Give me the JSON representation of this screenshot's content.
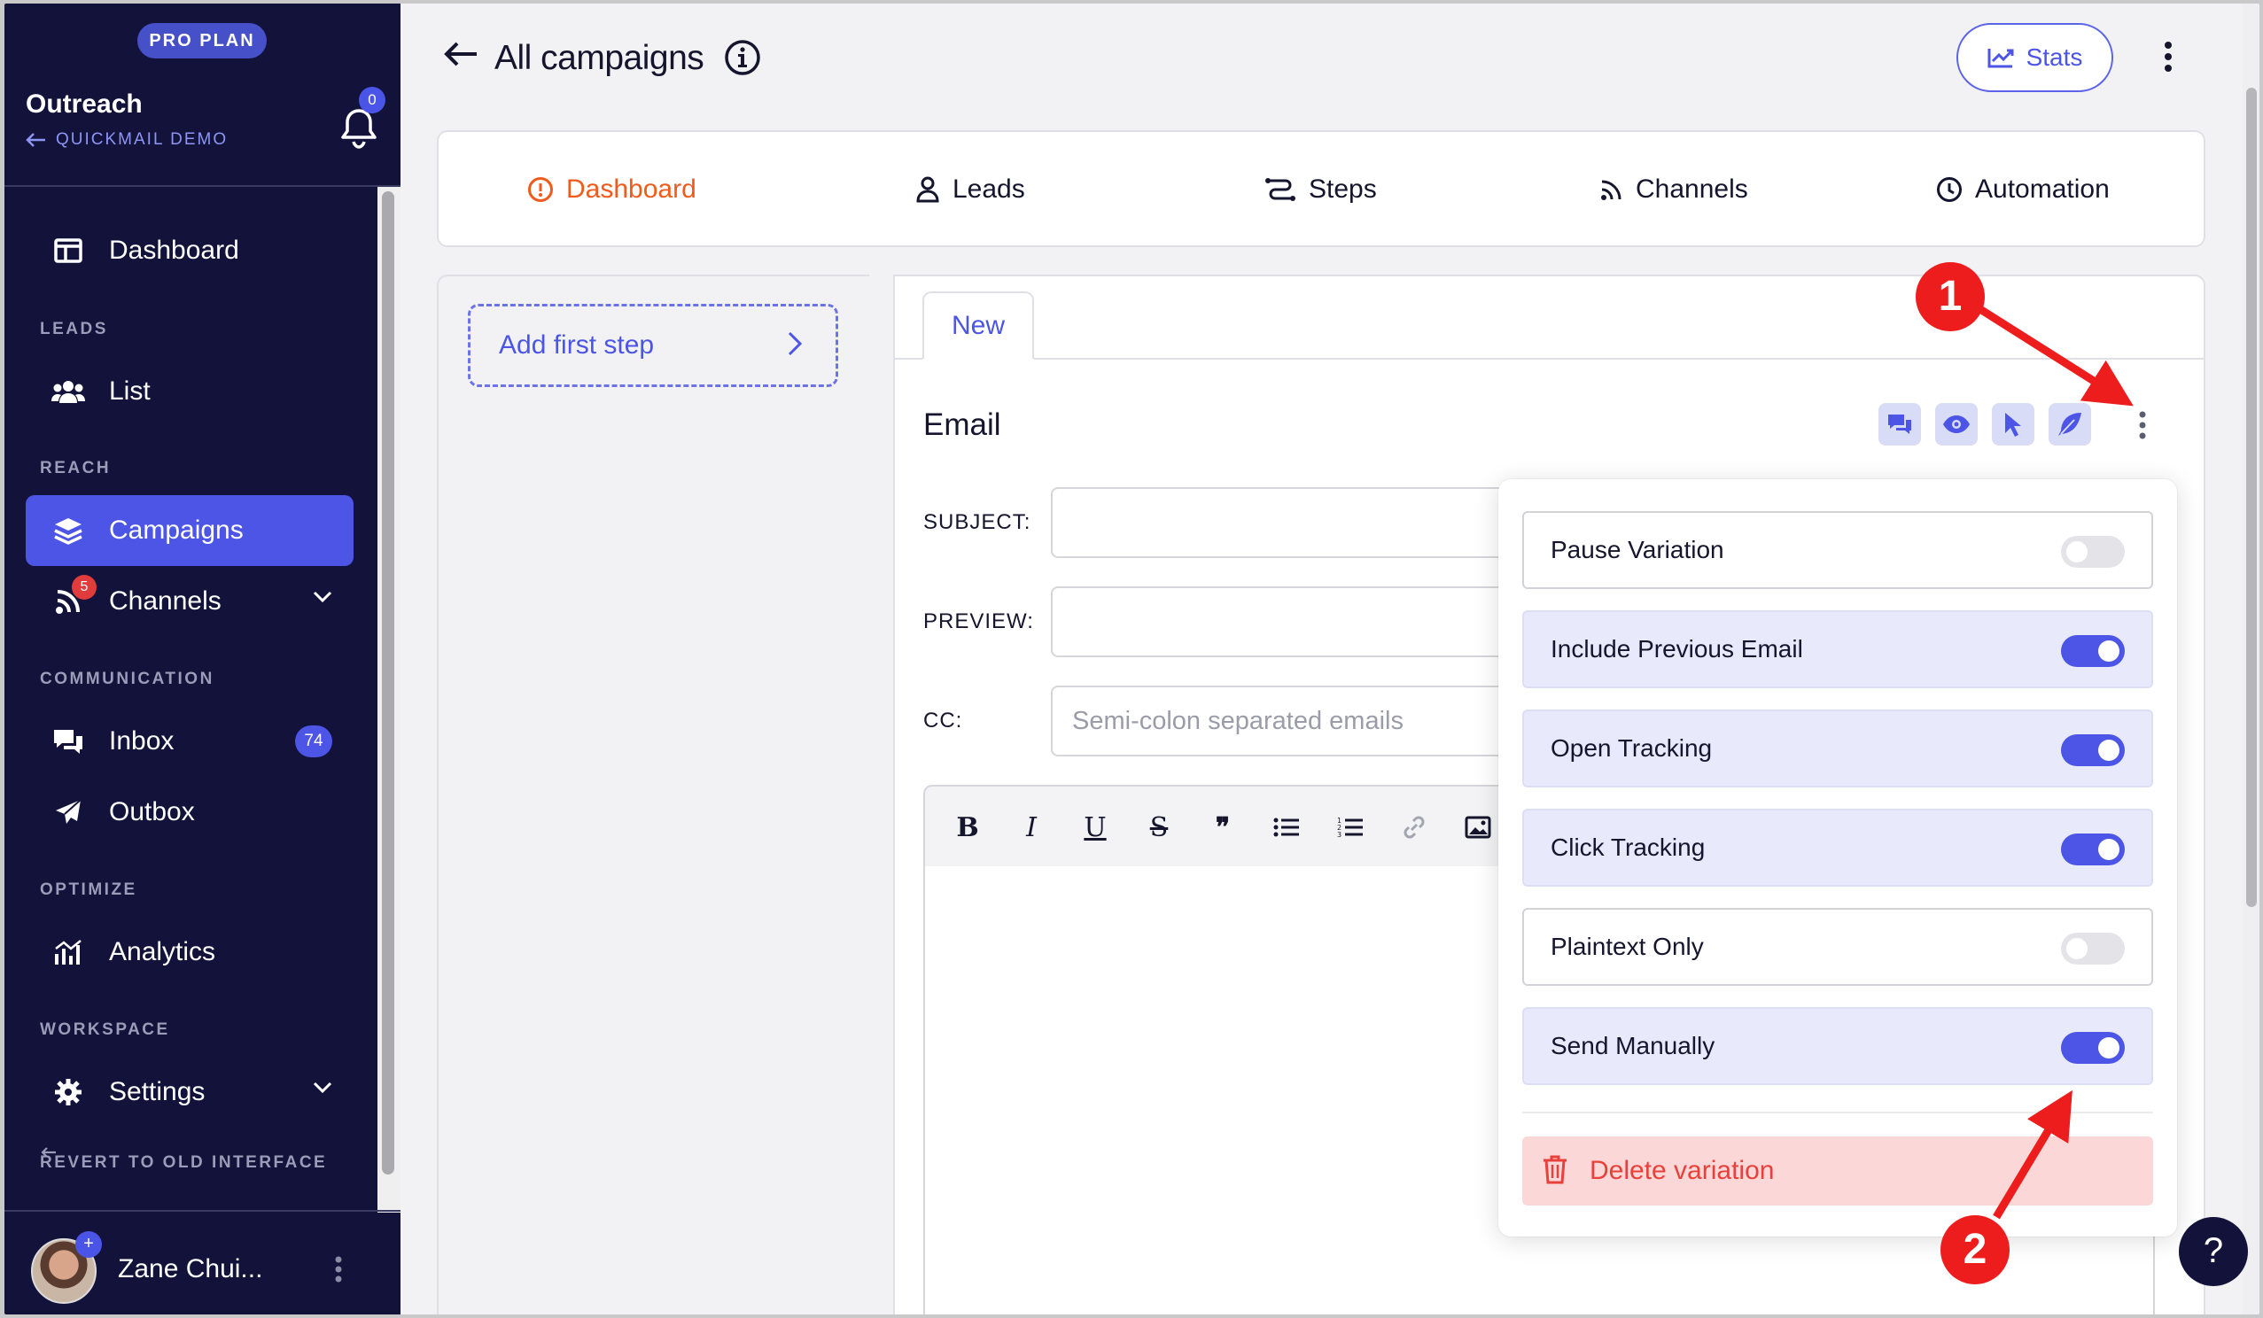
{
  "sidebar": {
    "plan_badge": "PRO PLAN",
    "org_name": "Outreach",
    "org_sub": "QUICKMAIL DEMO",
    "notification_count": "0",
    "sections": {
      "leads": "LEADS",
      "reach": "REACH",
      "communication": "COMMUNICATION",
      "optimize": "OPTIMIZE",
      "workspace": "WORKSPACE"
    },
    "items": {
      "dashboard": "Dashboard",
      "list": "List",
      "campaigns": "Campaigns",
      "channels": "Channels",
      "channels_badge": "5",
      "inbox": "Inbox",
      "inbox_badge": "74",
      "outbox": "Outbox",
      "analytics": "Analytics",
      "settings": "Settings"
    },
    "revert": "REVERT TO OLD INTERFACE",
    "user_name": "Zane Chui...",
    "avatar_plus": "+"
  },
  "header": {
    "title": "All campaigns",
    "stats_label": "Stats"
  },
  "tabs": [
    {
      "label": "Dashboard",
      "icon": "info-circle-icon"
    },
    {
      "label": "Leads",
      "icon": "user-icon"
    },
    {
      "label": "Steps",
      "icon": "steps-icon"
    },
    {
      "label": "Channels",
      "icon": "rss-icon"
    },
    {
      "label": "Automation",
      "icon": "clock-icon"
    }
  ],
  "steps": {
    "add_first_step": "Add first step"
  },
  "editor": {
    "variation_tab": "New",
    "title": "Email",
    "subject_label": "SUBJECT:",
    "preview_label": "PREVIEW:",
    "cc_label": "CC:",
    "subject_value": "",
    "preview_value": "",
    "cc_placeholder": "Semi-colon separated emails"
  },
  "menu": {
    "options": [
      {
        "label": "Pause Variation",
        "on": false
      },
      {
        "label": "Include Previous Email",
        "on": true
      },
      {
        "label": "Open Tracking",
        "on": true
      },
      {
        "label": "Click Tracking",
        "on": true
      },
      {
        "label": "Plaintext Only",
        "on": false
      },
      {
        "label": "Send Manually",
        "on": true
      }
    ],
    "delete_label": "Delete variation"
  },
  "annotations": {
    "marker_1": "1",
    "marker_2": "2"
  },
  "help": "?",
  "colors": {
    "sidebar_bg": "#12123a",
    "accent": "#4c55e6",
    "active_tab": "#f05a1c",
    "danger": "#e8403b",
    "annotation": "#ee1d1d"
  }
}
